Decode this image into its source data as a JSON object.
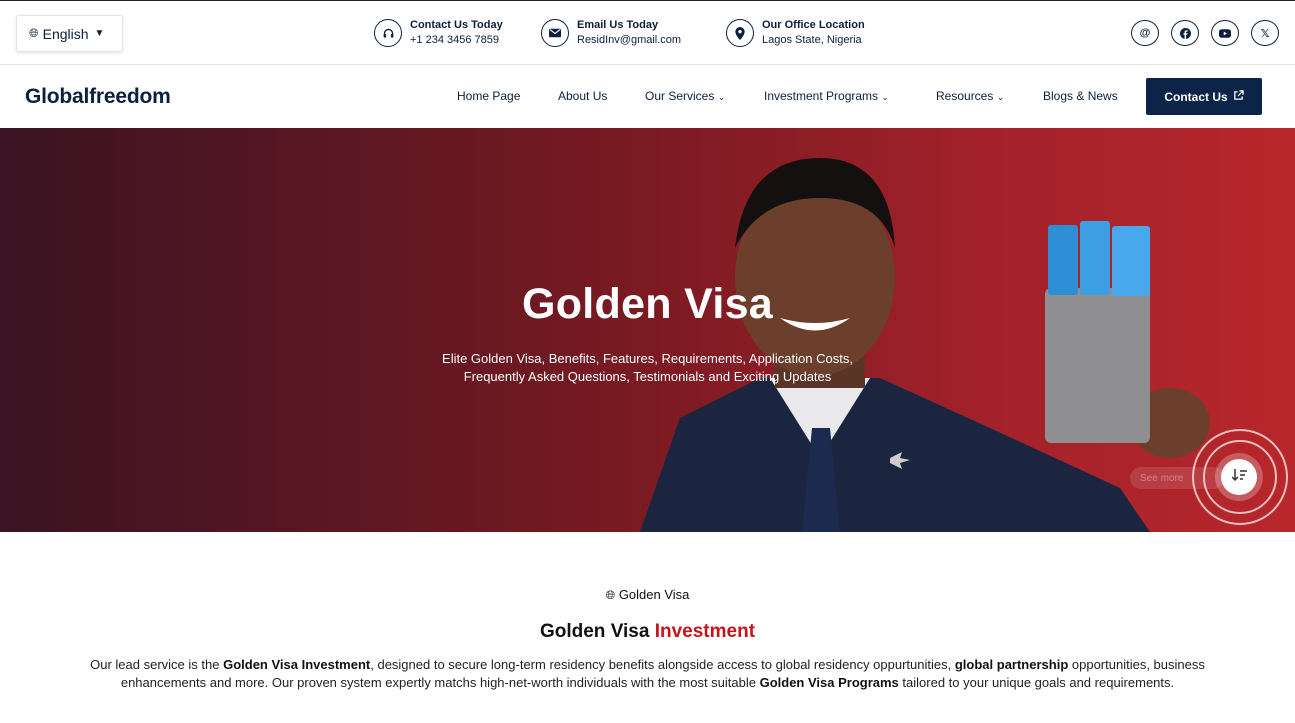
{
  "language": {
    "label": "English"
  },
  "contacts": [
    {
      "title": "Contact Us Today",
      "value": "+1 234 3456 7859",
      "icon": "headset-icon"
    },
    {
      "title": "Email Us Today",
      "value": "ResidInv@gmail.com",
      "icon": "envelope-icon"
    },
    {
      "title": "Our Office Location",
      "value": "Lagos State, Nigeria",
      "icon": "map-pin-icon"
    }
  ],
  "social": [
    "at-sign-icon",
    "facebook-icon",
    "youtube-icon",
    "x-twitter-icon"
  ],
  "logo": {
    "text": "Globalfreedom"
  },
  "nav": {
    "items": [
      "Home Page",
      "About Us",
      "Our Services",
      "Investment Programs",
      "Resources",
      "Blogs & News"
    ],
    "cta": "Contact Us"
  },
  "hero": {
    "title": "Golden Visa",
    "subtitle_line1": "Elite Golden Visa, Benefits, Features, Requirements, Application Costs,",
    "subtitle_line2": "Frequently Asked Questions, Testimonials and Exciting Updates",
    "see_more": "See more"
  },
  "section": {
    "eyebrow": "Golden Visa",
    "heading_main": "Golden Visa",
    "heading_accent": "Investment",
    "p1": "Our lead service is the ",
    "b1": "Golden Visa Investment",
    "p2": ", designed to secure long-term residency benefits alongside access to global residency oppurtunities, ",
    "b2": "global partnership",
    "p3": " opportunities, business enhancements and more. Our proven system expertly matchs high-net-worth individuals with the most suitable ",
    "b3": "Golden Visa Programs",
    "p4": " tailored to your unique goals and requirements."
  },
  "colors": {
    "navy": "#0b2447",
    "accent_red": "#c2161c",
    "hero_dark": "#3a1322",
    "hero_light": "#b8272b"
  }
}
